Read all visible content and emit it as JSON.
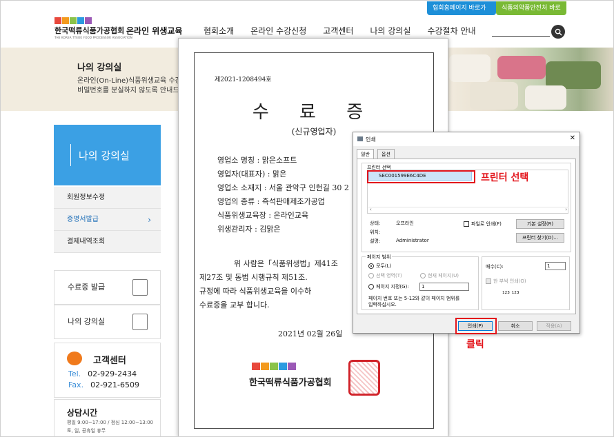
{
  "top_links": {
    "association": "협회홈페이지 바로가기 >",
    "food_safety": "식품의약품안전처 바로가기 >"
  },
  "logo": {
    "name": "한국떡류식품가공협회",
    "sub": "THE KOREA TTEOK FOOD PROCESSOR ASSOCIATION",
    "tag": "온라인 위생교육"
  },
  "nav": [
    "협회소개",
    "온라인 수강신청",
    "고객센터",
    "나의 강의실",
    "수강절차 안내"
  ],
  "banner": {
    "title": "나의 강의실",
    "line1": "온라인(On-Line)식품위생교육 수강",
    "line2": "비밀번호를 분실하지 않도록 안내드"
  },
  "sidebar": {
    "heading": "나의 강의실",
    "items": [
      "회원정보수정",
      "증명서발급",
      "결제내역조회"
    ],
    "quick": [
      "수료증 발급",
      "나의 강의실"
    ],
    "cs_title": "고객센터",
    "tel_label": "Tel.",
    "tel": "02-929-2434",
    "fax_label": "Fax.",
    "fax": "02-921-6509",
    "consult_title": "상담시간",
    "consult_hours": "평일 9:00~17:00 / 점심 12:00~13:00",
    "consult_off": "토, 일, 공휴일 휴무"
  },
  "certificate": {
    "number": "제2021-1208494호",
    "title": "수 료 증",
    "subtitle": "(신규영업자)",
    "lines": [
      "영업소 명칭 : 맑은소프트",
      "영업자(대표자) : 맑은",
      "영업소 소재지 : 서울 관악구 인헌길 30 2",
      "영업의 종류 : 즉석판매제조가공업",
      "식품위생교육장 : 온라인교육",
      "위생관리자 : 김맑은"
    ],
    "para": [
      "위 사람은「식품위생법」제41조",
      "제27조 및 동법 시행규칙 제51조.",
      "규정에 따라 식품위생교육을 이수하",
      "수료증을 교부 합니다."
    ],
    "date": "2021년 02월 26일",
    "org": "한국떡류식품가공협회"
  },
  "print_dialog": {
    "title": "인쇄",
    "tabs": [
      "일반",
      "옵션"
    ],
    "select_printer_label": "프린터 선택",
    "printer": "SEC001599E6C4DE",
    "status_label": "상태:",
    "status_value": "오프라인",
    "location_label": "위치:",
    "comment_label": "설명:",
    "comment_value": "Administrator",
    "print_to_file": "파일로 인쇄(F)",
    "preferences": "기본 설정(R)",
    "find_printer": "프린터 찾기(D)...",
    "page_range_label": "페이지 범위",
    "all": "모두(L)",
    "selection": "선택 영역(T)",
    "current_page": "현재 페이지(U)",
    "pages": "페이지 지정(G):",
    "pages_value": "1",
    "pages_hint_1": "페이지 번호 또는 5-12와 같이 페이지 범위를",
    "pages_hint_2": "입력하십시오.",
    "copies_label": "매수(C):",
    "copies_value": "1",
    "collate": "한 부씩 인쇄(O)",
    "print_button": "인쇄(P)",
    "cancel_button": "취소",
    "apply_button": "적용(A)"
  },
  "annotations": {
    "select_printer": "프린터 선택",
    "click": "클릭"
  },
  "colors": {
    "accent_blue": "#3ba0e4",
    "callout_red": "#e3141b",
    "green_link": "#79b934"
  }
}
